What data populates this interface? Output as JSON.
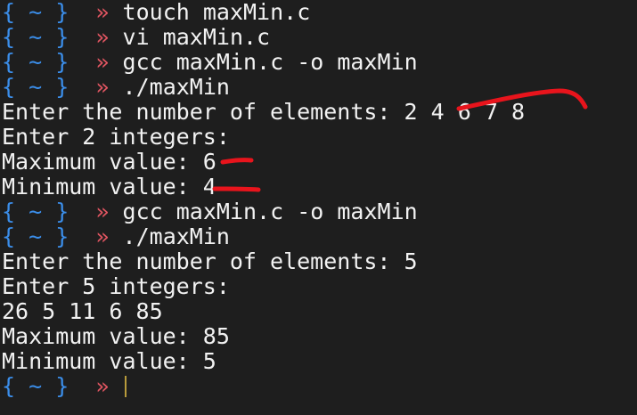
{
  "prompt": {
    "open_brace": "{",
    "tilde": "~",
    "close_brace": "}",
    "arrow": "»"
  },
  "lines": [
    {
      "type": "prompt",
      "command": "touch maxMin.c"
    },
    {
      "type": "prompt",
      "command": "vi maxMin.c"
    },
    {
      "type": "prompt",
      "command": "gcc maxMin.c -o maxMin"
    },
    {
      "type": "prompt",
      "command": "./maxMin"
    },
    {
      "type": "output",
      "text": "Enter the number of elements: 2 4 6 7 8"
    },
    {
      "type": "output",
      "text": "Enter 2 integers:"
    },
    {
      "type": "output",
      "text": "Maximum value: 6"
    },
    {
      "type": "output",
      "text": "Minimum value: 4"
    },
    {
      "type": "prompt",
      "command": "gcc maxMin.c -o maxMin"
    },
    {
      "type": "prompt",
      "command": "./maxMin"
    },
    {
      "type": "output",
      "text": "Enter the number of elements: 5"
    },
    {
      "type": "output",
      "text": "Enter 5 integers:"
    },
    {
      "type": "output",
      "text": "26 5 11 6 85"
    },
    {
      "type": "output",
      "text": "Maximum value: 85"
    },
    {
      "type": "output",
      "text": "Minimum value: 5"
    },
    {
      "type": "prompt",
      "command": ""
    }
  ],
  "colors": {
    "background": "#1e1e1e",
    "text": "#f2f2f2",
    "brace": "#3b8eea",
    "arrow": "#e05561",
    "annotation": "#e8141c",
    "cursor": "#b89b3c"
  }
}
